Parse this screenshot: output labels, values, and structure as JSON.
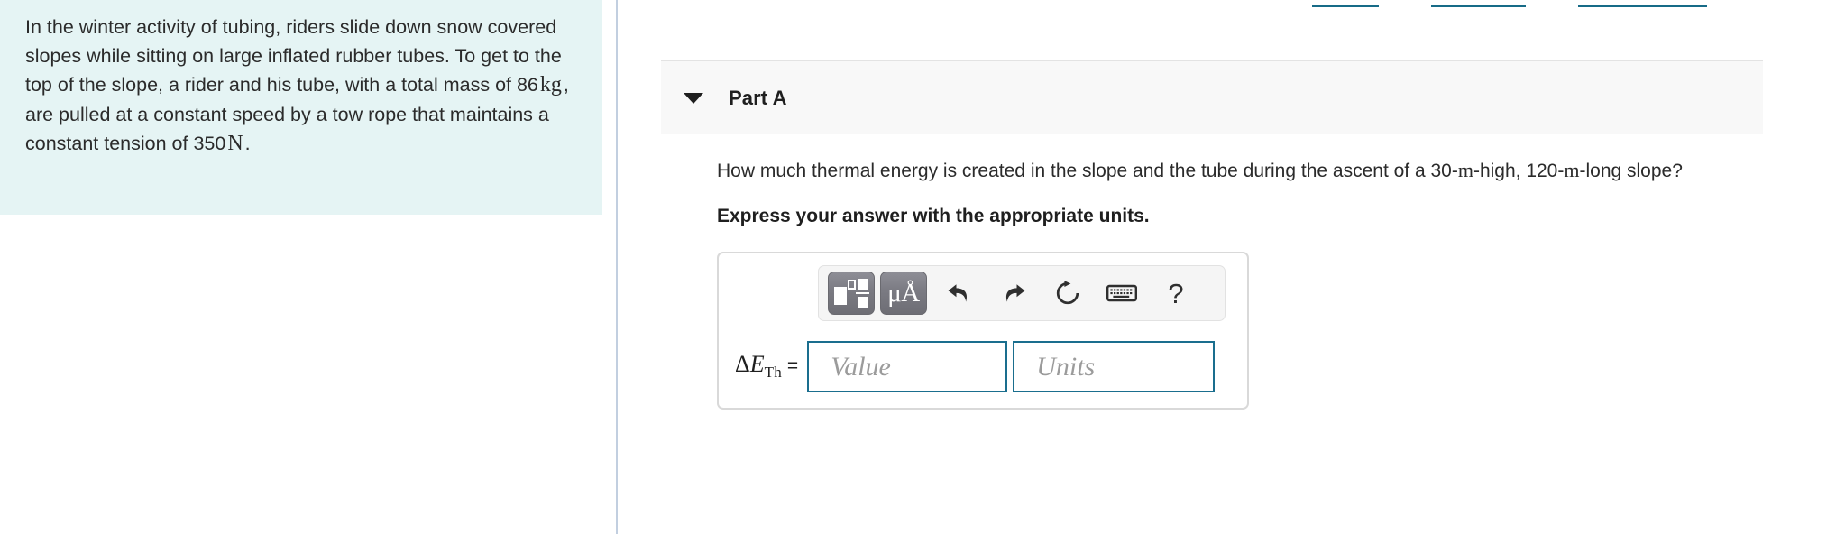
{
  "top_links": [
    {
      "label": ""
    },
    {
      "label": ""
    },
    {
      "label": ""
    }
  ],
  "problem": {
    "text_part1": "In the winter activity of tubing, riders slide down snow covered slopes while sitting on large inflated rubber tubes. To get to the top of the slope, a rider and his tube, with a total mass of 86",
    "mass_unit": "kg",
    "text_part2": ", are pulled at a constant speed by a tow rope that maintains a constant tension of 350",
    "tension_unit": "N",
    "text_part3": "."
  },
  "part": {
    "title": "Part A",
    "expanded": true,
    "disclosure_icon": "triangle-down-icon"
  },
  "question": {
    "text_part1": "How much thermal energy is created in the slope and the tube during the ascent of a 30-",
    "unit_m_1": "m",
    "text_part2": "-high, 120-",
    "unit_m_2": "m",
    "text_part3": "-long slope?",
    "instruction": "Express your answer with the appropriate units."
  },
  "toolbar": {
    "buttons": [
      {
        "name": "math-template-button",
        "label": ""
      },
      {
        "name": "units-mu-angstrom-button",
        "label": "μÅ"
      },
      {
        "name": "undo-button",
        "label": ""
      },
      {
        "name": "redo-button",
        "label": ""
      },
      {
        "name": "reset-button",
        "label": ""
      },
      {
        "name": "keyboard-shortcuts-button",
        "label": ""
      },
      {
        "name": "help-button",
        "label": "?"
      }
    ]
  },
  "answer": {
    "label_delta": "Δ",
    "label_symbol": "E",
    "label_subscript": "Th",
    "label_equals": "=",
    "value_placeholder": "Value",
    "units_placeholder": "Units",
    "value_text": "",
    "units_text": ""
  },
  "colors": {
    "problem_panel_bg": "#e5f4f4",
    "part_header_bg": "#f8f8f8",
    "input_border": "#1a6e8e",
    "divider": "#c2cfe0",
    "link_teal": "#176b87"
  }
}
